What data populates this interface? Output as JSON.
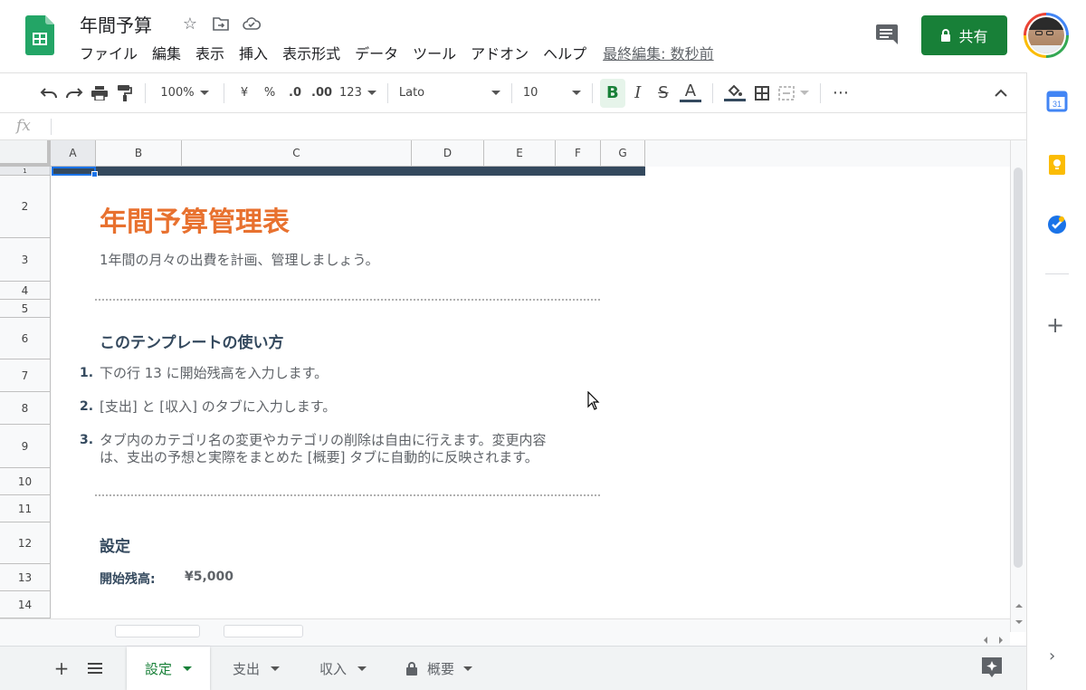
{
  "header": {
    "doc_title": "年間予算",
    "menu": [
      "ファイル",
      "編集",
      "表示",
      "挿入",
      "表示形式",
      "データ",
      "ツール",
      "アドオン",
      "ヘルプ"
    ],
    "last_edit": "最終編集: 数秒前",
    "share_label": "共有"
  },
  "toolbar": {
    "zoom": "100%",
    "currency": "¥",
    "percent": "%",
    "dec_less": ".0",
    "dec_more": ".00",
    "format_more": "123",
    "font": "Lato",
    "font_size": "10",
    "bold": "B",
    "italic": "I",
    "strike": "S",
    "text_color": "A",
    "more": "⋯"
  },
  "formula_bar": {
    "fx": "fx",
    "value": ""
  },
  "columns": [
    "A",
    "B",
    "C",
    "D",
    "E",
    "F",
    "G"
  ],
  "rows": [
    "1",
    "2",
    "3",
    "4",
    "5",
    "6",
    "7",
    "8",
    "9",
    "10",
    "11",
    "12",
    "13",
    "14"
  ],
  "sheet": {
    "title": "年間予算管理表",
    "subtitle": "1年間の月々の出費を計画、管理しましょう。",
    "howto_heading": "このテンプレートの使い方",
    "steps": [
      {
        "num": "1.",
        "text": "下の行 13 に開始残高を入力します。"
      },
      {
        "num": "2.",
        "text": "[支出] と [収入] のタブに入力します。"
      },
      {
        "num": "3.",
        "text": "タブ内のカテゴリ名の変更やカテゴリの削除は自由に行えます。変更内容",
        "text2": "は、支出の予想と実際をまとめた [概要] タブに自動的に反映されます。"
      }
    ],
    "settings_heading": "設定",
    "start_balance_label": "開始残高:",
    "start_balance_value": "¥5,000"
  },
  "tabs": [
    {
      "label": "設定",
      "active": true
    },
    {
      "label": "支出",
      "active": false
    },
    {
      "label": "収入",
      "active": false
    },
    {
      "label": "概要",
      "active": false,
      "locked": true
    }
  ],
  "colors": {
    "accent_green": "#188038",
    "title_orange": "#e8712f",
    "heading_navy": "#34495e"
  }
}
